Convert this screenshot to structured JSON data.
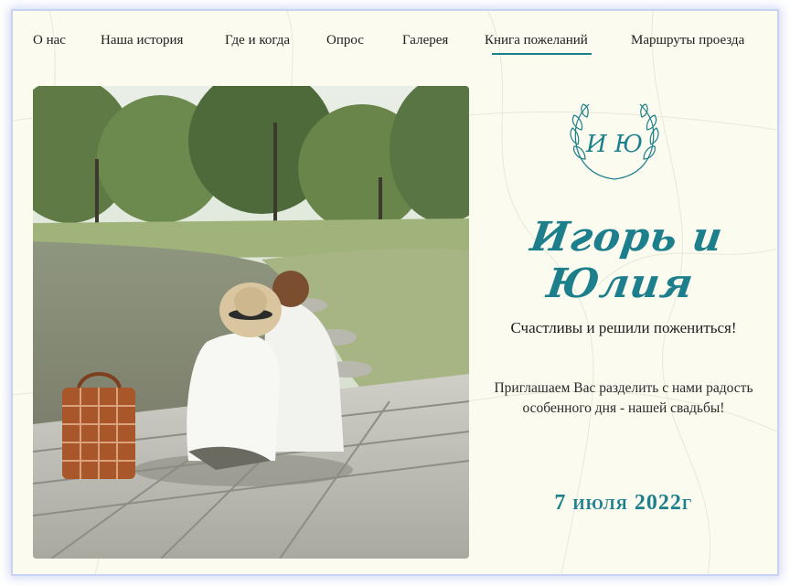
{
  "nav": {
    "items": [
      {
        "label": "О нас"
      },
      {
        "label": "Наша история"
      },
      {
        "label": "Где и когда"
      },
      {
        "label": "Опрос"
      },
      {
        "label": "Галерея"
      },
      {
        "label": "Книга пожеланий",
        "active": true
      },
      {
        "label": "Маршруты проезда"
      }
    ]
  },
  "hero": {
    "monogram": "И Ю",
    "names": "Игорь и Юлия",
    "tagline": "Счастливы и решили пожениться!",
    "invite": "Приглашаем Вас разделить с нами радость особенного дня - нашей свадьбы!",
    "date": "7 июля 2022г"
  },
  "colors": {
    "accent": "#1d7f8c",
    "background": "#fbfbef",
    "text": "#1e1e1e"
  }
}
